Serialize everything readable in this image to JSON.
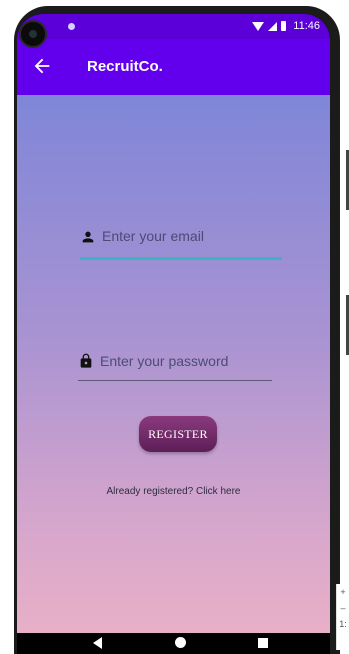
{
  "status_bar": {
    "time": "11:46"
  },
  "app_bar": {
    "title": "RecruitCo."
  },
  "form": {
    "email_placeholder": "Enter your email",
    "password_placeholder": "Enter your password",
    "register_label": "REGISTER",
    "login_link": "Already registered? Click here"
  },
  "side_widget": {
    "plus": "+",
    "minus": "–",
    "ratio": "1:"
  },
  "colors": {
    "app_bar": "#6200ee",
    "status_bar": "#5b00d9",
    "email_underline": "#3bb3c4",
    "button": "#6f2a68"
  },
  "icons": {
    "back": "arrow-left-icon",
    "email": "person-icon",
    "password": "lock-icon"
  }
}
